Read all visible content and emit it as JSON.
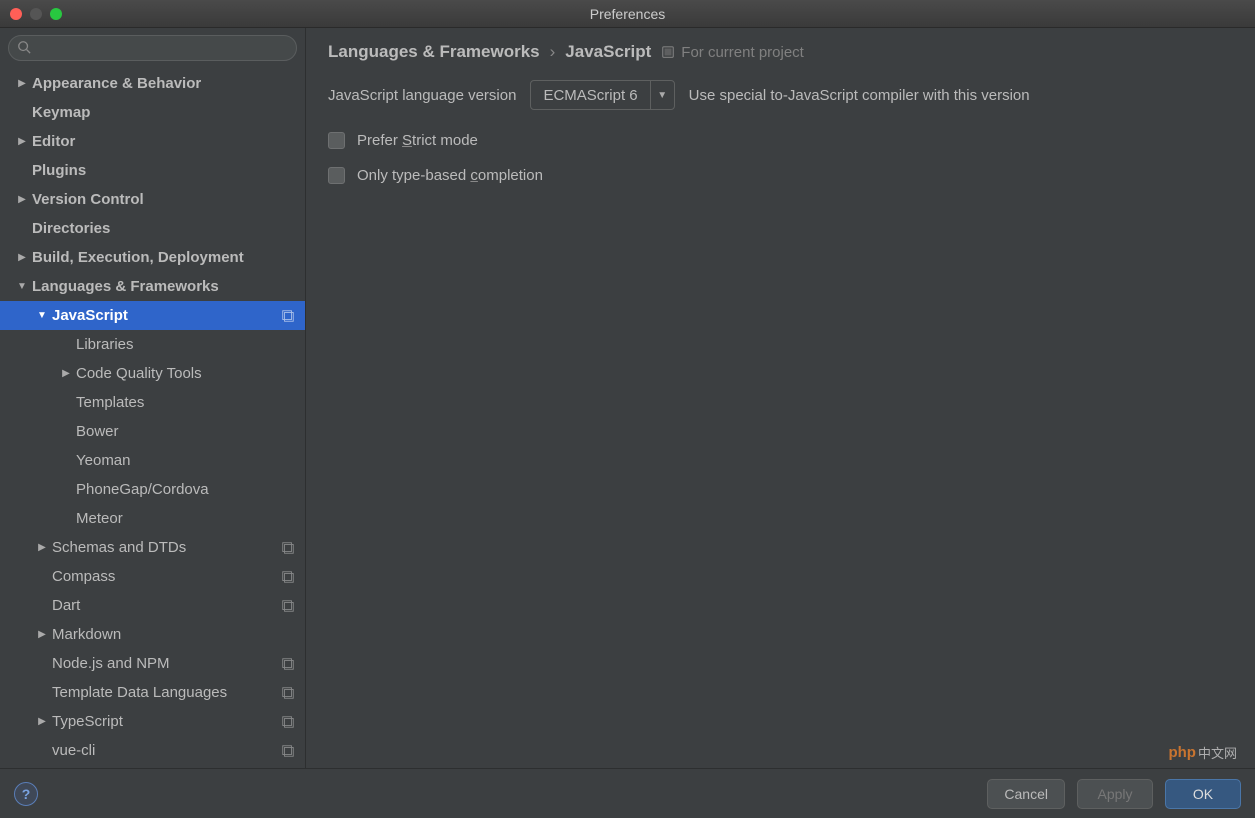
{
  "window": {
    "title": "Preferences"
  },
  "search": {
    "placeholder": ""
  },
  "tree": [
    {
      "label": "Appearance & Behavior",
      "indent": 0,
      "arrow": "right",
      "bold": true
    },
    {
      "label": "Keymap",
      "indent": 0,
      "arrow": "",
      "bold": true
    },
    {
      "label": "Editor",
      "indent": 0,
      "arrow": "right",
      "bold": true
    },
    {
      "label": "Plugins",
      "indent": 0,
      "arrow": "",
      "bold": true
    },
    {
      "label": "Version Control",
      "indent": 0,
      "arrow": "right",
      "bold": true
    },
    {
      "label": "Directories",
      "indent": 0,
      "arrow": "",
      "bold": true
    },
    {
      "label": "Build, Execution, Deployment",
      "indent": 0,
      "arrow": "right",
      "bold": true
    },
    {
      "label": "Languages & Frameworks",
      "indent": 0,
      "arrow": "down",
      "bold": true
    },
    {
      "label": "JavaScript",
      "indent": 1,
      "arrow": "down",
      "bold": true,
      "selected": true,
      "proj": true
    },
    {
      "label": "Libraries",
      "indent": 2,
      "arrow": ""
    },
    {
      "label": "Code Quality Tools",
      "indent": 2,
      "arrow": "right"
    },
    {
      "label": "Templates",
      "indent": 2,
      "arrow": ""
    },
    {
      "label": "Bower",
      "indent": 2,
      "arrow": ""
    },
    {
      "label": "Yeoman",
      "indent": 2,
      "arrow": ""
    },
    {
      "label": "PhoneGap/Cordova",
      "indent": 2,
      "arrow": ""
    },
    {
      "label": "Meteor",
      "indent": 2,
      "arrow": ""
    },
    {
      "label": "Schemas and DTDs",
      "indent": 1,
      "arrow": "right",
      "proj": true
    },
    {
      "label": "Compass",
      "indent": 1,
      "arrow": "",
      "proj": true
    },
    {
      "label": "Dart",
      "indent": 1,
      "arrow": "",
      "proj": true
    },
    {
      "label": "Markdown",
      "indent": 1,
      "arrow": "right"
    },
    {
      "label": "Node.js and NPM",
      "indent": 1,
      "arrow": "",
      "proj": true
    },
    {
      "label": "Template Data Languages",
      "indent": 1,
      "arrow": "",
      "proj": true
    },
    {
      "label": "TypeScript",
      "indent": 1,
      "arrow": "right",
      "proj": true
    },
    {
      "label": "vue-cli",
      "indent": 1,
      "arrow": "",
      "proj": true
    }
  ],
  "breadcrumb": {
    "a": "Languages & Frameworks",
    "sep": "›",
    "b": "JavaScript",
    "scope": "For current project"
  },
  "lang_version": {
    "label": "JavaScript language version",
    "value": "ECMAScript 6",
    "hint": "Use special to-JavaScript compiler with this version"
  },
  "checks": {
    "strict_pre": "Prefer ",
    "strict_u": "S",
    "strict_post": "trict mode",
    "type_pre": "Only type-based ",
    "type_u": "c",
    "type_post": "ompletion"
  },
  "buttons": {
    "cancel": "Cancel",
    "apply": "Apply",
    "ok": "OK"
  },
  "watermark": {
    "brand": "php",
    "zh": "中文网"
  }
}
